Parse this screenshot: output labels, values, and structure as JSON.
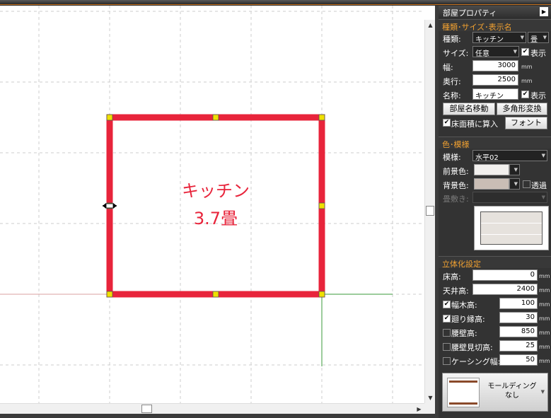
{
  "room": {
    "name": "キッチン",
    "area": "3.7畳",
    "colors": {
      "wall": "#e8243b",
      "handle": "#f0e000",
      "grid": "#cccccc"
    }
  },
  "panel": {
    "title": "部屋プロパティ",
    "sec_type": "種類･サイズ･表示名",
    "type_label": "種類:",
    "type_value": "キッチン",
    "type_unit": "畳",
    "size_label": "サイズ:",
    "size_value": "任意",
    "show_label_1": "表示",
    "width_label": "幅:",
    "width_value": "3000",
    "depth_label": "奥行:",
    "depth_value": "2500",
    "unit_mm": "mm",
    "name_label": "名称:",
    "name_value": "キッチン",
    "show_label_2": "表示",
    "btn_move_name": "部屋名移動",
    "btn_polygon": "多角形変換",
    "floor_area_label": "床面積に算入",
    "btn_font": "フォント",
    "sec_color": "色･模様",
    "pattern_label": "模様:",
    "pattern_value": "水平02",
    "fg_label": "前景色:",
    "bg_label": "背景色:",
    "transparent_label": "透過",
    "tatami_label": "畳敷き:",
    "sec_3d": "立体化設定",
    "floor_height_label": "床高:",
    "floor_height_value": "0",
    "ceiling_label": "天井高:",
    "ceiling_value": "2400",
    "baseboard_label": "幅木高:",
    "baseboard_value": "100",
    "molding_label": "廻り縁高:",
    "molding_value": "30",
    "wainscot_label": "腰壁高:",
    "wainscot_value": "850",
    "wainscot_trim_label": "腰壁見切高:",
    "wainscot_trim_value": "25",
    "casing_label": "ケーシング幅:",
    "casing_value": "50",
    "molding_btn": "モールディング\nなし",
    "fg_color": "#f2f0ee",
    "bg_color": "#c9bdb5"
  }
}
